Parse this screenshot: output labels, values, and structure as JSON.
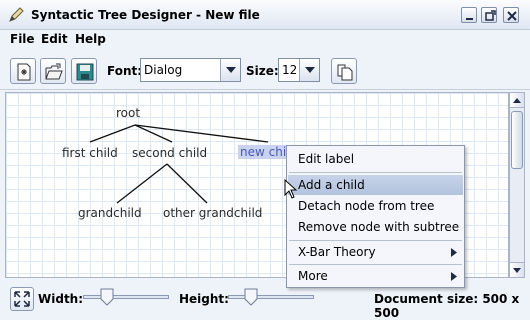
{
  "window": {
    "title": "Syntactic Tree Designer - New file",
    "app_icon": "pencil-icon",
    "controls": [
      "minimize-icon",
      "restore-icon",
      "close-icon"
    ]
  },
  "menubar": {
    "items": [
      {
        "label": "File"
      },
      {
        "label": "Edit"
      },
      {
        "label": "Help"
      }
    ]
  },
  "toolbar": {
    "buttons": [
      "new-file-icon",
      "open-folder-icon",
      "save-icon",
      "copy-icon"
    ],
    "font_label": "Font:",
    "font_value": "Dialog",
    "size_label": "Size:",
    "size_value": "12"
  },
  "tree": {
    "nodes": [
      {
        "id": "root",
        "label": "root"
      },
      {
        "id": "first",
        "label": "first child"
      },
      {
        "id": "second",
        "label": "second child"
      },
      {
        "id": "new",
        "label": "new child",
        "selected": true
      },
      {
        "id": "grand",
        "label": "grandchild"
      },
      {
        "id": "other",
        "label": "other grandchild"
      }
    ]
  },
  "context_menu": {
    "items": [
      {
        "label": "Edit label",
        "highlighted": false,
        "submenu": false
      },
      {
        "label": "Add a child",
        "highlighted": true,
        "submenu": false
      },
      {
        "label": "Detach node from tree",
        "highlighted": false,
        "submenu": false
      },
      {
        "label": "Remove node with subtree",
        "highlighted": false,
        "submenu": false
      },
      {
        "label": "X-Bar Theory",
        "highlighted": false,
        "submenu": true
      },
      {
        "label": "More",
        "highlighted": false,
        "submenu": true
      }
    ]
  },
  "statusbar": {
    "fit_icon": "expand-arrows-icon",
    "width_label": "Width:",
    "height_label": "Height:",
    "document_size": "Document size: 500 x 500"
  },
  "colors": {
    "selection_bg": "#c9d3f0",
    "menu_highlight": "#b9c7e0",
    "grid": "#dde8f5"
  }
}
